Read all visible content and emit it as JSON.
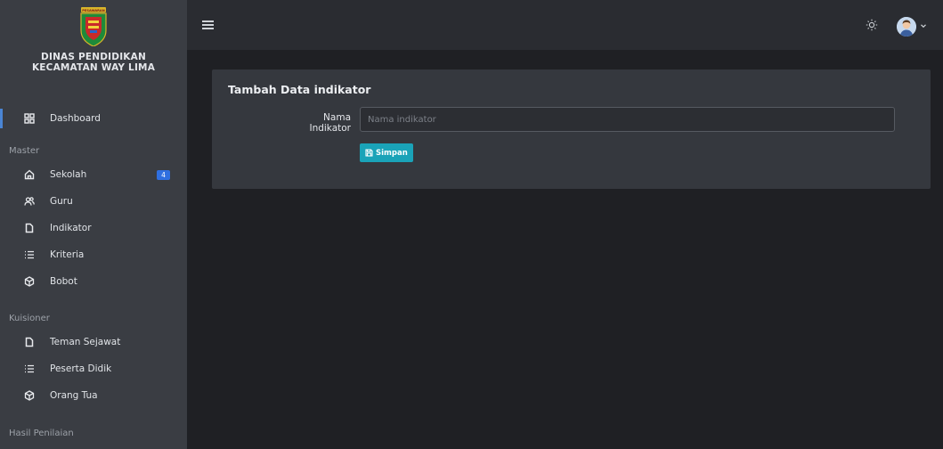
{
  "brand": {
    "logo_text": "PESAWARAN",
    "line1": "DINAS PENDIDIKAN",
    "line2": "KECAMATAN WAY LIMA"
  },
  "sidebar": {
    "dashboard": {
      "label": "Dashboard",
      "icon": "dashboard-grid-icon"
    },
    "master": {
      "title": "Master",
      "items": [
        {
          "label": "Sekolah",
          "icon": "home-icon",
          "badge": "4"
        },
        {
          "label": "Guru",
          "icon": "users-icon"
        },
        {
          "label": "Indikator",
          "icon": "file-icon"
        },
        {
          "label": "Kriteria",
          "icon": "list-icon"
        },
        {
          "label": "Bobot",
          "icon": "box-icon"
        }
      ]
    },
    "kuisioner": {
      "title": "Kuisioner",
      "items": [
        {
          "label": "Teman Sejawat",
          "icon": "file-icon"
        },
        {
          "label": "Peserta Didik",
          "icon": "list-icon"
        },
        {
          "label": "Orang Tua",
          "icon": "box-icon"
        }
      ]
    },
    "hasil": {
      "title": "Hasil Penilaian"
    }
  },
  "topbar": {
    "menu_icon": "hamburger-icon",
    "theme_icon": "sun-icon",
    "avatar_icon": "user-avatar"
  },
  "form": {
    "title": "Tambah Data indikator",
    "field_label": "Nama Indikator",
    "field_value": "",
    "field_placeholder": "Nama indikator",
    "save_label": "Simpan"
  },
  "colors": {
    "sidebar_bg": "#3a3d43",
    "body_bg": "#1f2024",
    "card_bg": "#35383e",
    "accent_button": "#1aa3b8",
    "badge": "#2f6fe0",
    "active_indicator": "#4a85d4"
  }
}
